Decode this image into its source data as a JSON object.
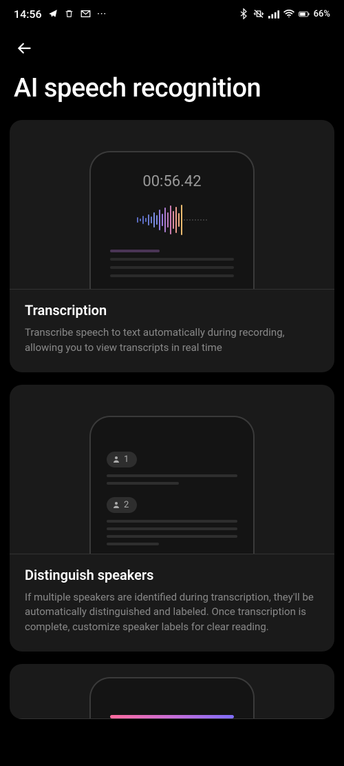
{
  "status_bar": {
    "time": "14:56",
    "battery_percent": "66%"
  },
  "page": {
    "title": "AI speech recognition"
  },
  "cards": [
    {
      "timer": "00:56.42",
      "title": "Transcription",
      "description": "Transcribe speech to text automatically during recording, allowing you to view transcripts in real time"
    },
    {
      "speaker1_label": "1",
      "speaker2_label": "2",
      "title": "Distinguish speakers",
      "description": "If multiple speakers are identified during transcription, they'll be automatically distinguished and labeled. Once transcription is complete, customize speaker labels for clear reading."
    }
  ]
}
